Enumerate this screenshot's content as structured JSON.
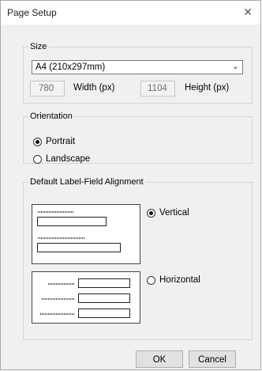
{
  "window": {
    "title": "Page Setup",
    "close_glyph": "✕"
  },
  "size": {
    "legend": "Size",
    "selected": "A4 (210x297mm)",
    "width_value": "780",
    "width_label": "Width (px)",
    "height_value": "1104",
    "height_label": "Height (px)"
  },
  "orientation": {
    "legend": "Orientation",
    "portrait_label": "Portrait",
    "landscape_label": "Landscape",
    "selected": "Portrait"
  },
  "alignment": {
    "legend": "Default Label-Field Alignment",
    "vertical_label": "Vertical",
    "horizontal_label": "Horizontal",
    "selected": "Vertical"
  },
  "buttons": {
    "ok_label": "OK",
    "cancel_label": "Cancel"
  }
}
